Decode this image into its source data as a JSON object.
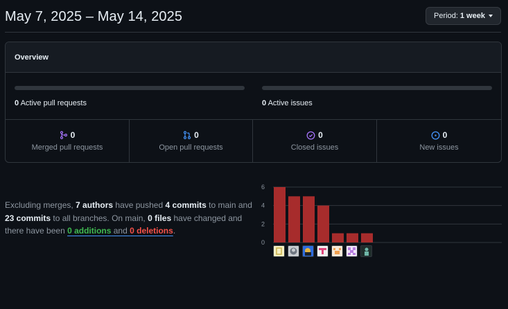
{
  "header": {
    "date_range": "May 7, 2025 – May 14, 2025",
    "period_prefix": "Period:",
    "period_value": "1 week"
  },
  "overview": {
    "title": "Overview",
    "active_pull_requests": {
      "count": "0",
      "label": "Active pull requests"
    },
    "active_issues": {
      "count": "0",
      "label": "Active issues"
    },
    "stats": [
      {
        "count": "0",
        "label": "Merged pull requests",
        "icon": "merge-icon",
        "color": "#a371f7"
      },
      {
        "count": "0",
        "label": "Open pull requests",
        "icon": "pull-request-icon",
        "color": "#3fb950"
      },
      {
        "count": "0",
        "label": "Closed issues",
        "icon": "closed-issue-icon",
        "color": "#a371f7"
      },
      {
        "count": "0",
        "label": "New issues",
        "icon": "issue-opened-icon",
        "color": "#3fb950"
      }
    ]
  },
  "summary": {
    "t1": "Excluding merges, ",
    "authors": "7 authors",
    "t2": " have pushed ",
    "commits_main": "4 commits",
    "t3": " to main and ",
    "commits_all": "23 commits",
    "t4": " to all branches. On main, ",
    "files": "0 files",
    "t5": " have changed and there have been ",
    "additions": "0 additions",
    "t6": " and ",
    "deletions": "0 deletions",
    "t7": "."
  },
  "chart_data": {
    "type": "bar",
    "values": [
      6,
      5,
      5,
      4,
      1,
      1,
      1
    ],
    "ylim": [
      0,
      6
    ],
    "yticks": [
      "0",
      "2",
      "4",
      "6"
    ],
    "bar_color": "#a72c2c",
    "grid": true
  },
  "colors": {
    "accent_blue": "#4493f8",
    "additions_green": "#3fb950",
    "deletions_red": "#f85149"
  }
}
